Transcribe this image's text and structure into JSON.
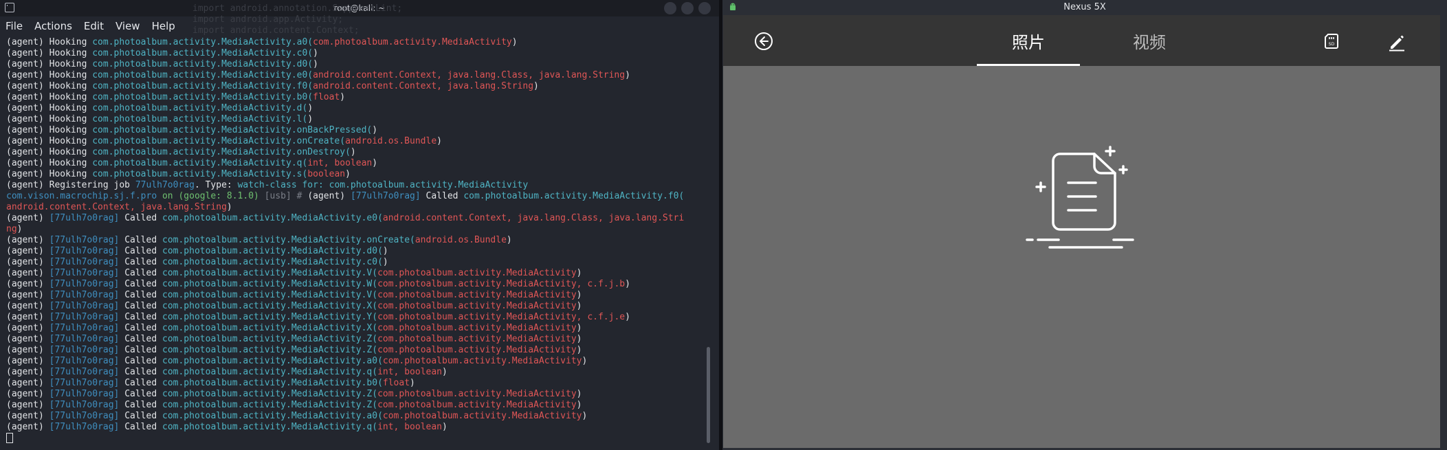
{
  "terminal": {
    "title": "root@kali: ~",
    "menu": [
      "File",
      "Actions",
      "Edit",
      "View",
      "Help"
    ],
    "lines": [
      [
        [
          "(agent) Hooking ",
          ""
        ],
        [
          "com.photoalbum.activity.MediaActivity.a0(",
          "c-cls"
        ],
        [
          "com.photoalbum.activity.MediaActivity",
          "c-arg"
        ],
        [
          ")",
          ""
        ]
      ],
      [
        [
          "(agent) Hooking ",
          ""
        ],
        [
          "com.photoalbum.activity.MediaActivity.c0(",
          "c-cls"
        ],
        [
          ")",
          ""
        ]
      ],
      [
        [
          "(agent) Hooking ",
          ""
        ],
        [
          "com.photoalbum.activity.MediaActivity.d0(",
          "c-cls"
        ],
        [
          ")",
          ""
        ]
      ],
      [
        [
          "(agent) Hooking ",
          ""
        ],
        [
          "com.photoalbum.activity.MediaActivity.e0(",
          "c-cls"
        ],
        [
          "android.content.Context, java.lang.Class, java.lang.String",
          "c-arg"
        ],
        [
          ")",
          ""
        ]
      ],
      [
        [
          "(agent) Hooking ",
          ""
        ],
        [
          "com.photoalbum.activity.MediaActivity.f0(",
          "c-cls"
        ],
        [
          "android.content.Context, java.lang.String",
          "c-arg"
        ],
        [
          ")",
          ""
        ]
      ],
      [
        [
          "(agent) Hooking ",
          ""
        ],
        [
          "com.photoalbum.activity.MediaActivity.b0(",
          "c-cls"
        ],
        [
          "float",
          "c-arg"
        ],
        [
          ")",
          ""
        ]
      ],
      [
        [
          "(agent) Hooking ",
          ""
        ],
        [
          "com.photoalbum.activity.MediaActivity.d(",
          "c-cls"
        ],
        [
          ")",
          ""
        ]
      ],
      [
        [
          "(agent) Hooking ",
          ""
        ],
        [
          "com.photoalbum.activity.MediaActivity.l(",
          "c-cls"
        ],
        [
          ")",
          ""
        ]
      ],
      [
        [
          "(agent) Hooking ",
          ""
        ],
        [
          "com.photoalbum.activity.MediaActivity.onBackPressed(",
          "c-cls"
        ],
        [
          ")",
          ""
        ]
      ],
      [
        [
          "(agent) Hooking ",
          ""
        ],
        [
          "com.photoalbum.activity.MediaActivity.onCreate(",
          "c-cls"
        ],
        [
          "android.os.Bundle",
          "c-arg"
        ],
        [
          ")",
          ""
        ]
      ],
      [
        [
          "(agent) Hooking ",
          ""
        ],
        [
          "com.photoalbum.activity.MediaActivity.onDestroy(",
          "c-cls"
        ],
        [
          ")",
          ""
        ]
      ],
      [
        [
          "(agent) Hooking ",
          ""
        ],
        [
          "com.photoalbum.activity.MediaActivity.q(",
          "c-cls"
        ],
        [
          "int, boolean",
          "c-arg"
        ],
        [
          ")",
          ""
        ]
      ],
      [
        [
          "(agent) Hooking ",
          ""
        ],
        [
          "com.photoalbum.activity.MediaActivity.s(",
          "c-cls"
        ],
        [
          "boolean",
          "c-arg"
        ],
        [
          ")",
          ""
        ]
      ],
      [
        [
          "(agent) Registering job ",
          ""
        ],
        [
          "77ulh7o0rag",
          "c-job"
        ],
        [
          ". Type: ",
          ""
        ],
        [
          "watch-class for: com.photoalbum.activity.MediaActivity",
          "c-grn"
        ]
      ],
      [
        [
          "com.vison.macrochip.sj.f.pro",
          "c-job"
        ],
        [
          " on ",
          "c-on"
        ],
        [
          "(google: 8.1.0) ",
          "c-on"
        ],
        [
          "[usb] # ",
          "c-dim"
        ],
        [
          "(agent) ",
          ""
        ],
        [
          "[77ulh7o0rag]",
          "c-job"
        ],
        [
          " Called ",
          ""
        ],
        [
          "com.photoalbum.activity.MediaActivity.f0(",
          "c-cls"
        ]
      ],
      [
        [
          "android.content.Context, java.lang.String",
          "c-arg"
        ],
        [
          ")",
          ""
        ]
      ],
      [
        [
          "(agent) ",
          ""
        ],
        [
          "[77ulh7o0rag]",
          "c-job"
        ],
        [
          " Called ",
          ""
        ],
        [
          "com.photoalbum.activity.MediaActivity.e0(",
          "c-cls"
        ],
        [
          "android.content.Context, java.lang.Class, java.lang.Stri",
          "c-arg"
        ]
      ],
      [
        [
          "ng",
          "c-arg"
        ],
        [
          ")",
          ""
        ]
      ],
      [
        [
          "(agent) ",
          ""
        ],
        [
          "[77ulh7o0rag]",
          "c-job"
        ],
        [
          " Called ",
          ""
        ],
        [
          "com.photoalbum.activity.MediaActivity.onCreate(",
          "c-cls"
        ],
        [
          "android.os.Bundle",
          "c-arg"
        ],
        [
          ")",
          ""
        ]
      ],
      [
        [
          "(agent) ",
          ""
        ],
        [
          "[77ulh7o0rag]",
          "c-job"
        ],
        [
          " Called ",
          ""
        ],
        [
          "com.photoalbum.activity.MediaActivity.d0(",
          "c-cls"
        ],
        [
          ")",
          ""
        ]
      ],
      [
        [
          "(agent) ",
          ""
        ],
        [
          "[77ulh7o0rag]",
          "c-job"
        ],
        [
          " Called ",
          ""
        ],
        [
          "com.photoalbum.activity.MediaActivity.c0(",
          "c-cls"
        ],
        [
          ")",
          ""
        ]
      ],
      [
        [
          "(agent) ",
          ""
        ],
        [
          "[77ulh7o0rag]",
          "c-job"
        ],
        [
          " Called ",
          ""
        ],
        [
          "com.photoalbum.activity.MediaActivity.V(",
          "c-cls"
        ],
        [
          "com.photoalbum.activity.MediaActivity",
          "c-arg"
        ],
        [
          ")",
          ""
        ]
      ],
      [
        [
          "(agent) ",
          ""
        ],
        [
          "[77ulh7o0rag]",
          "c-job"
        ],
        [
          " Called ",
          ""
        ],
        [
          "com.photoalbum.activity.MediaActivity.W(",
          "c-cls"
        ],
        [
          "com.photoalbum.activity.MediaActivity, c.f.j.b",
          "c-arg"
        ],
        [
          ")",
          ""
        ]
      ],
      [
        [
          "(agent) ",
          ""
        ],
        [
          "[77ulh7o0rag]",
          "c-job"
        ],
        [
          " Called ",
          ""
        ],
        [
          "com.photoalbum.activity.MediaActivity.V(",
          "c-cls"
        ],
        [
          "com.photoalbum.activity.MediaActivity",
          "c-arg"
        ],
        [
          ")",
          ""
        ]
      ],
      [
        [
          "(agent) ",
          ""
        ],
        [
          "[77ulh7o0rag]",
          "c-job"
        ],
        [
          " Called ",
          ""
        ],
        [
          "com.photoalbum.activity.MediaActivity.X(",
          "c-cls"
        ],
        [
          "com.photoalbum.activity.MediaActivity",
          "c-arg"
        ],
        [
          ")",
          ""
        ]
      ],
      [
        [
          "(agent) ",
          ""
        ],
        [
          "[77ulh7o0rag]",
          "c-job"
        ],
        [
          " Called ",
          ""
        ],
        [
          "com.photoalbum.activity.MediaActivity.Y(",
          "c-cls"
        ],
        [
          "com.photoalbum.activity.MediaActivity, c.f.j.e",
          "c-arg"
        ],
        [
          ")",
          ""
        ]
      ],
      [
        [
          "(agent) ",
          ""
        ],
        [
          "[77ulh7o0rag]",
          "c-job"
        ],
        [
          " Called ",
          ""
        ],
        [
          "com.photoalbum.activity.MediaActivity.X(",
          "c-cls"
        ],
        [
          "com.photoalbum.activity.MediaActivity",
          "c-arg"
        ],
        [
          ")",
          ""
        ]
      ],
      [
        [
          "(agent) ",
          ""
        ],
        [
          "[77ulh7o0rag]",
          "c-job"
        ],
        [
          " Called ",
          ""
        ],
        [
          "com.photoalbum.activity.MediaActivity.Z(",
          "c-cls"
        ],
        [
          "com.photoalbum.activity.MediaActivity",
          "c-arg"
        ],
        [
          ")",
          ""
        ]
      ],
      [
        [
          "(agent) ",
          ""
        ],
        [
          "[77ulh7o0rag]",
          "c-job"
        ],
        [
          " Called ",
          ""
        ],
        [
          "com.photoalbum.activity.MediaActivity.Z(",
          "c-cls"
        ],
        [
          "com.photoalbum.activity.MediaActivity",
          "c-arg"
        ],
        [
          ")",
          ""
        ]
      ],
      [
        [
          "(agent) ",
          ""
        ],
        [
          "[77ulh7o0rag]",
          "c-job"
        ],
        [
          " Called ",
          ""
        ],
        [
          "com.photoalbum.activity.MediaActivity.a0(",
          "c-cls"
        ],
        [
          "com.photoalbum.activity.MediaActivity",
          "c-arg"
        ],
        [
          ")",
          ""
        ]
      ],
      [
        [
          "(agent) ",
          ""
        ],
        [
          "[77ulh7o0rag]",
          "c-job"
        ],
        [
          " Called ",
          ""
        ],
        [
          "com.photoalbum.activity.MediaActivity.q(",
          "c-cls"
        ],
        [
          "int, boolean",
          "c-arg"
        ],
        [
          ")",
          ""
        ]
      ],
      [
        [
          "(agent) ",
          ""
        ],
        [
          "[77ulh7o0rag]",
          "c-job"
        ],
        [
          " Called ",
          ""
        ],
        [
          "com.photoalbum.activity.MediaActivity.b0(",
          "c-cls"
        ],
        [
          "float",
          "c-arg"
        ],
        [
          ")",
          ""
        ]
      ],
      [
        [
          "(agent) ",
          ""
        ],
        [
          "[77ulh7o0rag]",
          "c-job"
        ],
        [
          " Called ",
          ""
        ],
        [
          "com.photoalbum.activity.MediaActivity.Z(",
          "c-cls"
        ],
        [
          "com.photoalbum.activity.MediaActivity",
          "c-arg"
        ],
        [
          ")",
          ""
        ]
      ],
      [
        [
          "(agent) ",
          ""
        ],
        [
          "[77ulh7o0rag]",
          "c-job"
        ],
        [
          " Called ",
          ""
        ],
        [
          "com.photoalbum.activity.MediaActivity.Z(",
          "c-cls"
        ],
        [
          "com.photoalbum.activity.MediaActivity",
          "c-arg"
        ],
        [
          ")",
          ""
        ]
      ],
      [
        [
          "(agent) ",
          ""
        ],
        [
          "[77ulh7o0rag]",
          "c-job"
        ],
        [
          " Called ",
          ""
        ],
        [
          "com.photoalbum.activity.MediaActivity.a0(",
          "c-cls"
        ],
        [
          "com.photoalbum.activity.MediaActivity",
          "c-arg"
        ],
        [
          ")",
          ""
        ]
      ],
      [
        [
          "(agent) ",
          ""
        ],
        [
          "[77ulh7o0rag]",
          "c-job"
        ],
        [
          " Called ",
          ""
        ],
        [
          "com.photoalbum.activity.MediaActivity.q(",
          "c-cls"
        ],
        [
          "int, boolean",
          "c-arg"
        ],
        [
          ")",
          ""
        ]
      ]
    ],
    "ghost_text": "import android.annotation.SuppressLint;\nimport android.app.Activity;\nimport android.content.Context;"
  },
  "emulator": {
    "title": "Nexus 5X",
    "tabs": [
      "照片",
      "视频"
    ],
    "selected_tab": "照片",
    "icons": [
      "back-icon",
      "sd-card-icon",
      "edit-icon",
      "empty-document-icon"
    ]
  },
  "colors": {
    "terminal_bg": "#23262e",
    "class_cyan": "#4fb4c4",
    "arg_red": "#e05656",
    "job_blue": "#3f8fc0",
    "appbar": "#353535",
    "content_bg": "#6b6b6b"
  }
}
